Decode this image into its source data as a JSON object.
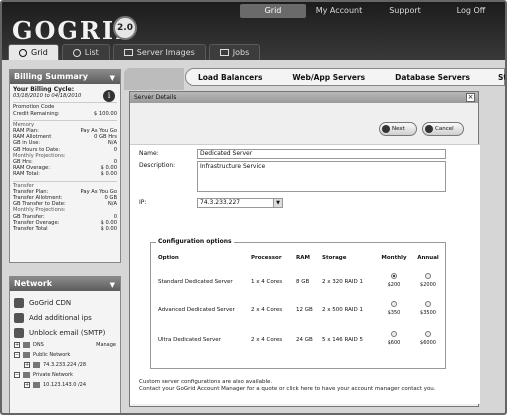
{
  "header": {
    "logo": "GOGRID",
    "logo_badge": "2.0",
    "nav": [
      "Grid",
      "My Account",
      "Support",
      "Log Off"
    ],
    "tabs": [
      "Grid",
      "List",
      "Server Images",
      "Jobs"
    ]
  },
  "billing": {
    "title": "Billing Summary",
    "cycle_label": "Your Billing Cycle:",
    "cycle_range": "03/18/2010 to 04/18/2010",
    "promo_label": "Promotion Code",
    "credit_label": "Credit Remaining:",
    "credit_value": "$ 100.00",
    "memory_label": "Memory",
    "ram_plan_label": "RAM Plan:",
    "ram_plan_value": "Pay As You Go",
    "ram_allot_label": "RAM Allotment",
    "ram_allot_value": "0 GB Hrs",
    "gb_inuse_label": "GB in Use:",
    "gb_inuse_value": "N/A",
    "gb_hours_label": "GB Hours to Date:",
    "gb_hours_value": "0",
    "monthly_proj": "Monthly Projections:",
    "gb_hrs_label": "GB Hrs:",
    "gb_hrs_value": "0",
    "ram_overage_label": "RAM Overage:",
    "ram_overage_value": "$ 0.00",
    "ram_total_label": "RAM Total:",
    "ram_total_value": "$ 0.00",
    "transfer_label": "Transfer",
    "tr_plan_label": "Transfer Plan:",
    "tr_plan_value": "Pay As You Go",
    "tr_allot_label": "Transfer Allotment:",
    "tr_allot_value": "0 GB",
    "gb_tr_label": "GB Transfer to Date:",
    "gb_tr_value": "N/A",
    "monthly_proj2": "Monthly Projections:",
    "gb_transfer_label": "GB Transfer:",
    "gb_transfer_value": "0",
    "tr_overage_label": "Transfer Overage:",
    "tr_overage_value": "$ 0.00",
    "tr_total_label": "Transfer Total",
    "tr_total_value": "$ 0.00"
  },
  "network": {
    "title": "Network",
    "items": [
      "GoGrid CDN",
      "Add additional ips",
      "Unblock email (SMTP)"
    ],
    "tree": {
      "dns": "DNS",
      "manage": "Manage",
      "public": "Public Network",
      "public_ip": "74.3.233.224 /28",
      "private": "Private Network",
      "private_ip": "10.123.143.0 /24"
    }
  },
  "subtabs": [
    "Load Balancers",
    "Web/App Servers",
    "Database Servers",
    "Storage"
  ],
  "dialog": {
    "title": "Server Details",
    "next": "Next",
    "cancel": "Cancel",
    "name_label": "Name:",
    "name_value": "Dedicated Server",
    "desc_label": "Description:",
    "desc_value": "Infrastructure Service",
    "ip_label": "IP:",
    "ip_value": "74.3.233.227",
    "config_title": "Configuration options",
    "columns": [
      "Option",
      "Processor",
      "RAM",
      "Storage",
      "Monthly",
      "Annual"
    ],
    "rows": [
      {
        "option": "Standard Dedicated Server",
        "proc": "1 x 4 Cores",
        "ram": "8 GB",
        "storage": "2 x 320 RAID 1",
        "monthly": "$200",
        "annual": "$2000",
        "monthly_selected": true
      },
      {
        "option": "Advanced Dedicated Server",
        "proc": "2 x 4 Cores",
        "ram": "12 GB",
        "storage": "2 x 500 RAID 1",
        "monthly": "$350",
        "annual": "$3500",
        "monthly_selected": false
      },
      {
        "option": "Ultra Dedicated Server",
        "proc": "2 x 4 Cores",
        "ram": "24 GB",
        "storage": "5 x 146 RAID 5",
        "monthly": "$600",
        "annual": "$6000",
        "monthly_selected": false
      }
    ],
    "footer_1": "Custom server configurations are also available.",
    "footer_2": "Contact your GoGrid Account Manager for a quote or click here to have your account manager contact you."
  }
}
